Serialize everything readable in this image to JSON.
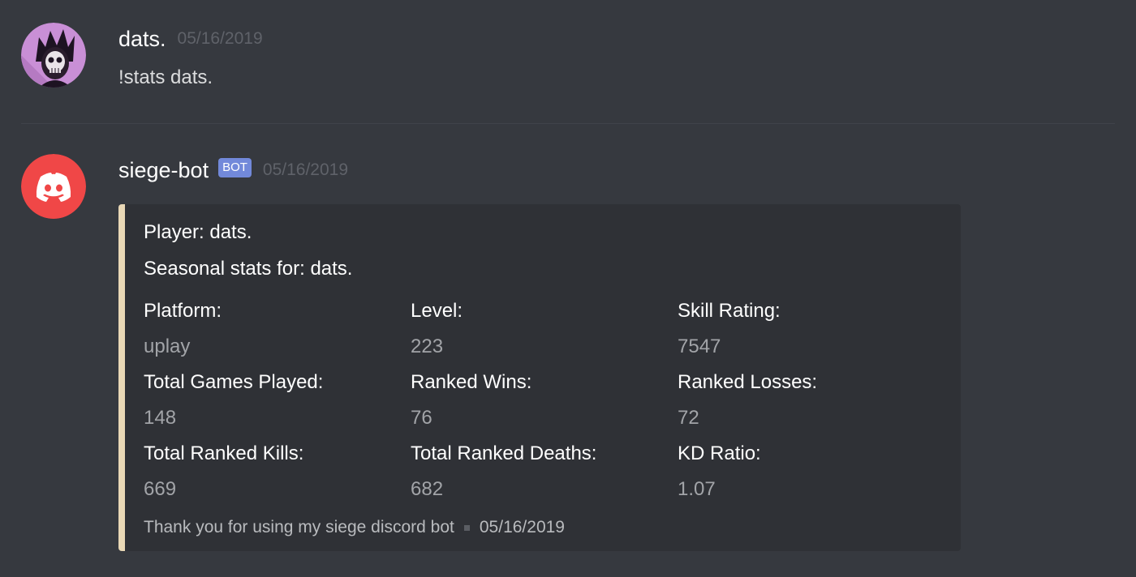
{
  "messages": [
    {
      "username": "dats.",
      "timestamp": "05/16/2019",
      "content": "!stats dats.",
      "avatar_icon": "skull-crown-avatar-icon"
    },
    {
      "username": "siege-bot",
      "bot_tag": "BOT",
      "timestamp": "05/16/2019",
      "avatar_icon": "discord-logo-avatar-icon",
      "embed": {
        "accent_color": "#e9d8b6",
        "line1": "Player: dats.",
        "line2": "Seasonal stats for: dats.",
        "fields": [
          {
            "name": "Platform:",
            "value": "uplay"
          },
          {
            "name": "Level:",
            "value": "223"
          },
          {
            "name": "Skill Rating:",
            "value": "7547"
          },
          {
            "name": "Total Games Played:",
            "value": "148"
          },
          {
            "name": "Ranked Wins:",
            "value": "76"
          },
          {
            "name": "Ranked Losses:",
            "value": "72"
          },
          {
            "name": "Total Ranked Kills:",
            "value": "669"
          },
          {
            "name": "Total Ranked Deaths:",
            "value": "682"
          },
          {
            "name": "KD Ratio:",
            "value": "1.07"
          }
        ],
        "footer_text": "Thank you for using my siege discord bot",
        "footer_timestamp": "05/16/2019"
      }
    }
  ],
  "colors": {
    "background": "#36393f",
    "embed_background": "#2f3136",
    "bot_tag": "#7289da",
    "discord_avatar": "#f04747"
  }
}
